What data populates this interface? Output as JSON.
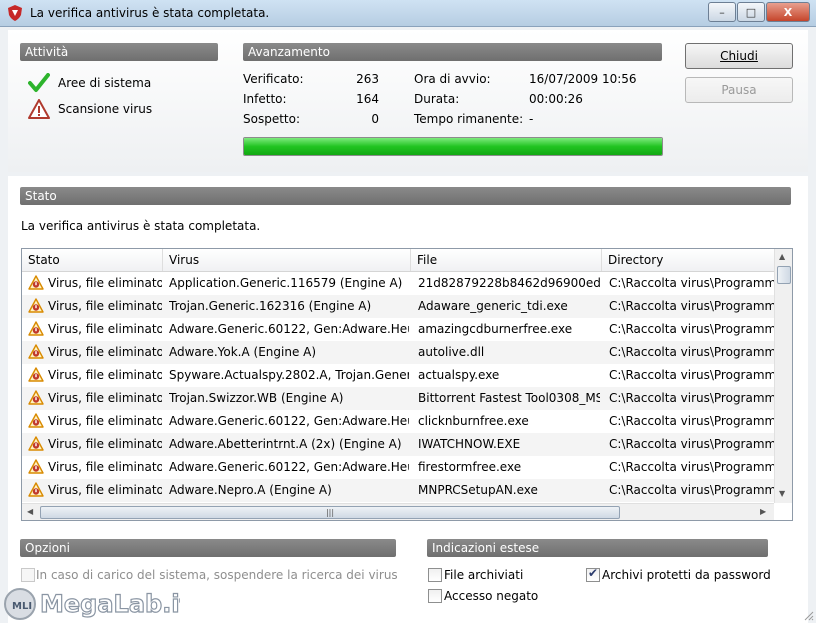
{
  "window": {
    "title": "La verifica antivirus è stata completata.",
    "controls": {
      "minimize": "–",
      "maximize": "□",
      "close": "X"
    }
  },
  "activity": {
    "header": "Attività",
    "items": [
      {
        "label": "Aree di sistema",
        "icon": "checkmark-icon",
        "color": "#2db42d"
      },
      {
        "label": "Scansione virus",
        "icon": "warning-icon",
        "color": "#c0392b"
      }
    ]
  },
  "progress": {
    "header": "Avanzamento",
    "verified_label": "Verificato:",
    "verified_value": "263",
    "infected_label": "Infetto:",
    "infected_value": "164",
    "suspect_label": "Sospetto:",
    "suspect_value": "0",
    "start_label": "Ora di avvio:",
    "start_value": "16/07/2009 10:56",
    "duration_label": "Durata:",
    "duration_value": "00:00:26",
    "remaining_label": "Tempo rimanente:",
    "remaining_value": "-",
    "fraction": 1.0,
    "bar_color": "#21c421"
  },
  "buttons": {
    "close": "Chiudi",
    "pause": "Pausa"
  },
  "status": {
    "header": "Stato",
    "message": "La verifica antivirus è stata completata."
  },
  "table": {
    "columns": [
      "Stato",
      "Virus",
      "File",
      "Directory"
    ],
    "rows": [
      {
        "status": "Virus, file eliminato",
        "virus": "Application.Generic.116579 (Engine A)",
        "file": "21d82879228b8462d96900ed1508...",
        "directory": "C:\\Raccolta virus\\Programmi co"
      },
      {
        "status": "Virus, file eliminato",
        "virus": "Trojan.Generic.162316 (Engine A)",
        "file": "Adaware_generic_tdi.exe",
        "directory": "C:\\Raccolta virus\\Programmi co"
      },
      {
        "status": "Virus, file eliminato",
        "virus": "Adware.Generic.60122, Gen:Adware.Heur.60...",
        "file": "amazingcdburnerfree.exe",
        "directory": "C:\\Raccolta virus\\Programmi co"
      },
      {
        "status": "Virus, file eliminato",
        "virus": "Adware.Yok.A (Engine A)",
        "file": "autolive.dll",
        "directory": "C:\\Raccolta virus\\Programmi co"
      },
      {
        "status": "Virus, file eliminato",
        "virus": "Spyware.Actualspy.2802.A, Trojan.Generic.4...",
        "file": "actualspy.exe",
        "directory": "C:\\Raccolta virus\\Programmi co"
      },
      {
        "status": "Virus, file eliminato",
        "virus": "Trojan.Swizzor.WB (Engine A)",
        "file": "Bittorrent Fastest Tool0308_MS-1...",
        "directory": "C:\\Raccolta virus\\Programmi co"
      },
      {
        "status": "Virus, file eliminato",
        "virus": "Adware.Generic.60122, Gen:Adware.Heur.60...",
        "file": "clicknburnfree.exe",
        "directory": "C:\\Raccolta virus\\Programmi co"
      },
      {
        "status": "Virus, file eliminato",
        "virus": "Adware.Abetterintrnt.A (2x) (Engine A)",
        "file": "IWATCHNOW.EXE",
        "directory": "C:\\Raccolta virus\\Programmi co"
      },
      {
        "status": "Virus, file eliminato",
        "virus": "Adware.Generic.60122, Gen:Adware.Heur.01...",
        "file": "firestormfree.exe",
        "directory": "C:\\Raccolta virus\\Programmi co"
      },
      {
        "status": "Virus, file eliminato",
        "virus": "Adware.Nepro.A (Engine A)",
        "file": "MNPRCSetupAN.exe",
        "directory": "C:\\Raccolta virus\\Programmi co"
      }
    ]
  },
  "options": {
    "header": "Opzioni",
    "suspend_on_load": {
      "label": "In caso di carico del sistema, sospendere la ricerca dei virus",
      "checked": false,
      "enabled": false
    }
  },
  "extended": {
    "header": "Indicazioni estese",
    "archived_files": {
      "label": "File archiviati",
      "checked": false
    },
    "access_denied": {
      "label": "Accesso negato",
      "checked": false
    },
    "password_archives": {
      "label": "Archivi protetti da password",
      "checked": true
    }
  },
  "watermark": {
    "text": "MegaLab.it"
  }
}
